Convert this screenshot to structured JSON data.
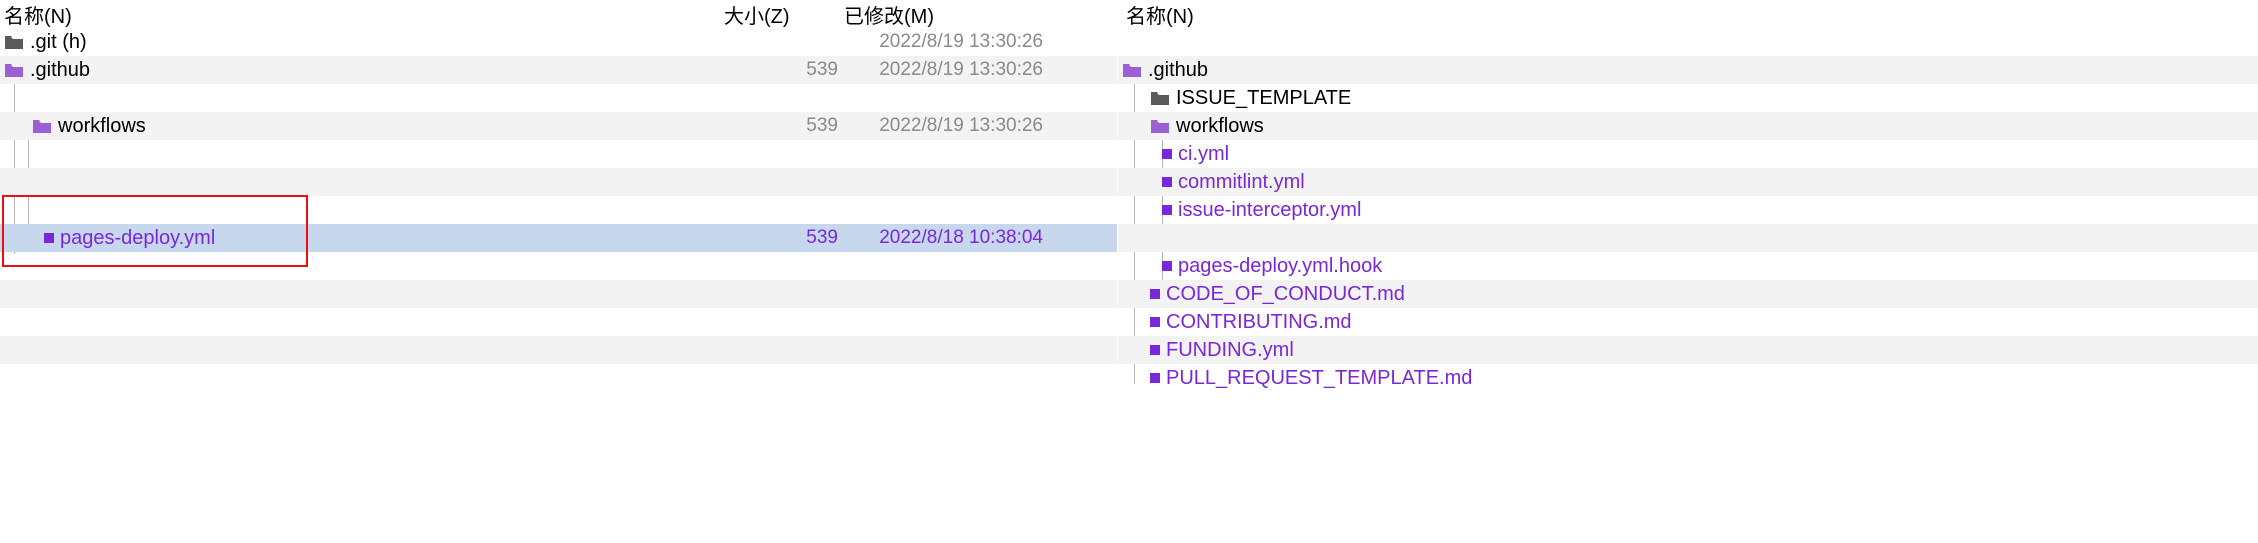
{
  "left": {
    "headers": {
      "name": "名称(N)",
      "size": "大小(Z)",
      "modified": "已修改(M)"
    },
    "rows": [
      {
        "type": "folder-dark",
        "indent": 0,
        "name": ".git (h)",
        "size": "",
        "modified": "2022/8/19 13:30:26",
        "alt": false
      },
      {
        "type": "folder",
        "indent": 0,
        "name": ".github",
        "size": "539",
        "modified": "2022/8/19 13:30:26",
        "alt": true
      },
      {
        "type": "blank",
        "indent": 0,
        "name": "",
        "size": "",
        "modified": "",
        "alt": false
      },
      {
        "type": "folder",
        "indent": 1,
        "name": "workflows",
        "size": "539",
        "modified": "2022/8/19 13:30:26",
        "alt": true
      },
      {
        "type": "blank",
        "indent": 0,
        "name": "",
        "size": "",
        "modified": "",
        "alt": false
      },
      {
        "type": "blank",
        "indent": 0,
        "name": "",
        "size": "",
        "modified": "",
        "alt": true
      },
      {
        "type": "blank",
        "indent": 0,
        "name": "",
        "size": "",
        "modified": "",
        "alt": false
      },
      {
        "type": "file",
        "indent": 2,
        "name": "pages-deploy.yml",
        "size": "539",
        "modified": "2022/8/18 10:38:04",
        "alt": true,
        "selected": true
      },
      {
        "type": "blank",
        "indent": 0,
        "name": "",
        "size": "",
        "modified": "",
        "alt": false
      },
      {
        "type": "blank",
        "indent": 0,
        "name": "",
        "size": "",
        "modified": "",
        "alt": true
      },
      {
        "type": "blank",
        "indent": 0,
        "name": "",
        "size": "",
        "modified": "",
        "alt": false
      },
      {
        "type": "blank",
        "indent": 0,
        "name": "",
        "size": "",
        "modified": "",
        "alt": true
      },
      {
        "type": "blank",
        "indent": 0,
        "name": "",
        "size": "",
        "modified": "",
        "alt": false
      }
    ]
  },
  "right": {
    "headers": {
      "name": "名称(N)"
    },
    "rows": [
      {
        "type": "blank",
        "indent": 0,
        "name": "",
        "alt": false
      },
      {
        "type": "folder",
        "indent": 0,
        "name": ".github",
        "alt": true
      },
      {
        "type": "folder-dark",
        "indent": 1,
        "name": "ISSUE_TEMPLATE",
        "alt": false
      },
      {
        "type": "folder",
        "indent": 1,
        "name": "workflows",
        "alt": true
      },
      {
        "type": "file",
        "indent": 2,
        "name": "ci.yml",
        "alt": false
      },
      {
        "type": "file",
        "indent": 2,
        "name": "commitlint.yml",
        "alt": true
      },
      {
        "type": "file",
        "indent": 2,
        "name": "issue-interceptor.yml",
        "alt": false
      },
      {
        "type": "blank",
        "indent": 2,
        "name": "",
        "alt": true
      },
      {
        "type": "file",
        "indent": 2,
        "name": "pages-deploy.yml.hook",
        "alt": false
      },
      {
        "type": "file",
        "indent": 1,
        "name": "CODE_OF_CONDUCT.md",
        "alt": true
      },
      {
        "type": "file",
        "indent": 1,
        "name": "CONTRIBUTING.md",
        "alt": false
      },
      {
        "type": "file",
        "indent": 1,
        "name": "FUNDING.yml",
        "alt": true
      },
      {
        "type": "file",
        "indent": 1,
        "name": "PULL_REQUEST_TEMPLATE.md",
        "alt": false
      }
    ]
  }
}
